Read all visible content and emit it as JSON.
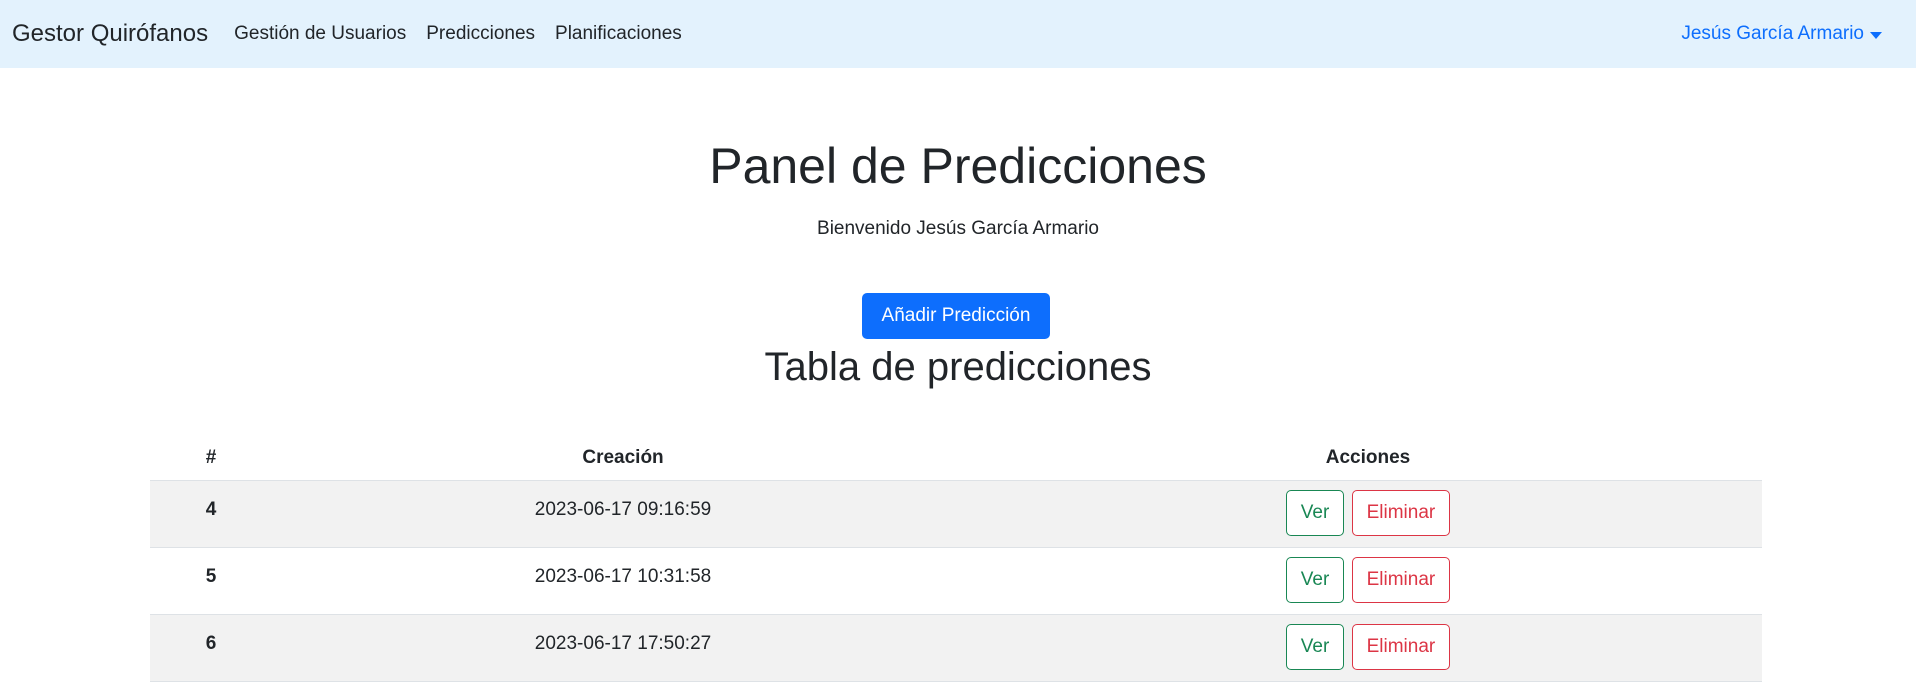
{
  "navbar": {
    "brand": "Gestor Quirófanos",
    "links": [
      "Gestión de Usuarios",
      "Predicciones",
      "Planificaciones"
    ],
    "user": "Jesús García Armario"
  },
  "main": {
    "title": "Panel de Predicciones",
    "welcome": "Bienvenido Jesús García Armario",
    "add_button": "Añadir Predicción",
    "table_title": "Tabla de predicciones"
  },
  "table": {
    "headers": [
      "#",
      "Creación",
      "Acciones"
    ],
    "rows": [
      {
        "id": "4",
        "created": "2023-06-17 09:16:59",
        "view": "Ver",
        "delete": "Eliminar"
      },
      {
        "id": "5",
        "created": "2023-06-17 10:31:58",
        "view": "Ver",
        "delete": "Eliminar"
      },
      {
        "id": "6",
        "created": "2023-06-17 17:50:27",
        "view": "Ver",
        "delete": "Eliminar"
      }
    ]
  },
  "colors": {
    "navbar_bg": "#e3f2fd",
    "primary": "#0d6efd",
    "success": "#198754",
    "danger": "#dc3545"
  }
}
